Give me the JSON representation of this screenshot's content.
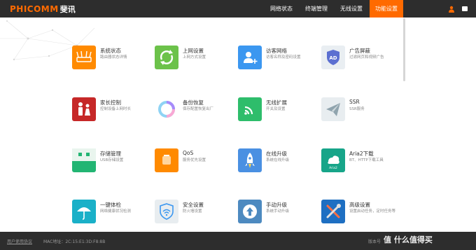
{
  "brand": {
    "en": "PHICOMM",
    "cn": "斐讯"
  },
  "nav": [
    {
      "label": "网络状态"
    },
    {
      "label": "终端管理"
    },
    {
      "label": "无线设置"
    },
    {
      "label": "功能设置",
      "active": true
    }
  ],
  "accent_color": "#ff6a00",
  "tiles": [
    {
      "title": "系统状态",
      "desc": "路由器状态详情",
      "icon": "router-icon",
      "color": "#ff8a00"
    },
    {
      "title": "上网设置",
      "desc": "上网方式设置",
      "icon": "refresh-icon",
      "color": "#6cc24a"
    },
    {
      "title": "访客网络",
      "desc": "访客名称及密码设置",
      "icon": "add-user-icon",
      "color": "#3b97f0"
    },
    {
      "title": "广告屏蔽",
      "desc": "过滤网页和视频广告",
      "icon": "ad-block-icon",
      "color": "#e9eef2"
    },
    {
      "title": "家长控制",
      "desc": "控制设备上网时长",
      "icon": "family-icon",
      "color": "#c62828"
    },
    {
      "title": "备份恢复",
      "desc": "保存配置恢复出厂",
      "icon": "backup-ring-icon",
      "color": "#ffffff"
    },
    {
      "title": "无线扩展",
      "desc": "开关及设置",
      "icon": "wifi-icon",
      "color": "#2ebd6b"
    },
    {
      "title": "SSR",
      "desc": "SSR服务",
      "icon": "paper-plane-icon",
      "color": "#e8edf0"
    },
    {
      "title": "存储管理",
      "desc": "USB存储设置",
      "icon": "storage-icon",
      "color": "#22b573"
    },
    {
      "title": "QoS",
      "desc": "服务优先设置",
      "icon": "qos-icon",
      "color": "#ff8a00"
    },
    {
      "title": "在线升级",
      "desc": "系统在线升级",
      "icon": "rocket-icon",
      "color": "#4a90e2"
    },
    {
      "title": "Aria2下载",
      "desc": "BT、HTTP下载工具",
      "icon": "aria2-icon",
      "color": "#17a589"
    },
    {
      "title": "一键体检",
      "desc": "网络健康状况检测",
      "icon": "umbrella-icon",
      "color": "#1ab0c8"
    },
    {
      "title": "安全设置",
      "desc": "防火墙设置",
      "icon": "shield-wifi-icon",
      "color": "#e8edf0"
    },
    {
      "title": "手动升级",
      "desc": "系统手动升级",
      "icon": "upload-icon",
      "color": "#4d8ac0"
    },
    {
      "title": "高级设置",
      "desc": "设置启动任务，定时任务等",
      "icon": "tools-icon",
      "color": "#1e6fc2"
    }
  ],
  "footer": {
    "link": "用户使用协议",
    "mac": "MAC地址：2C:15:E1:3D:F8:8B",
    "version": "版本号"
  },
  "watermark": "值 什么值得买"
}
